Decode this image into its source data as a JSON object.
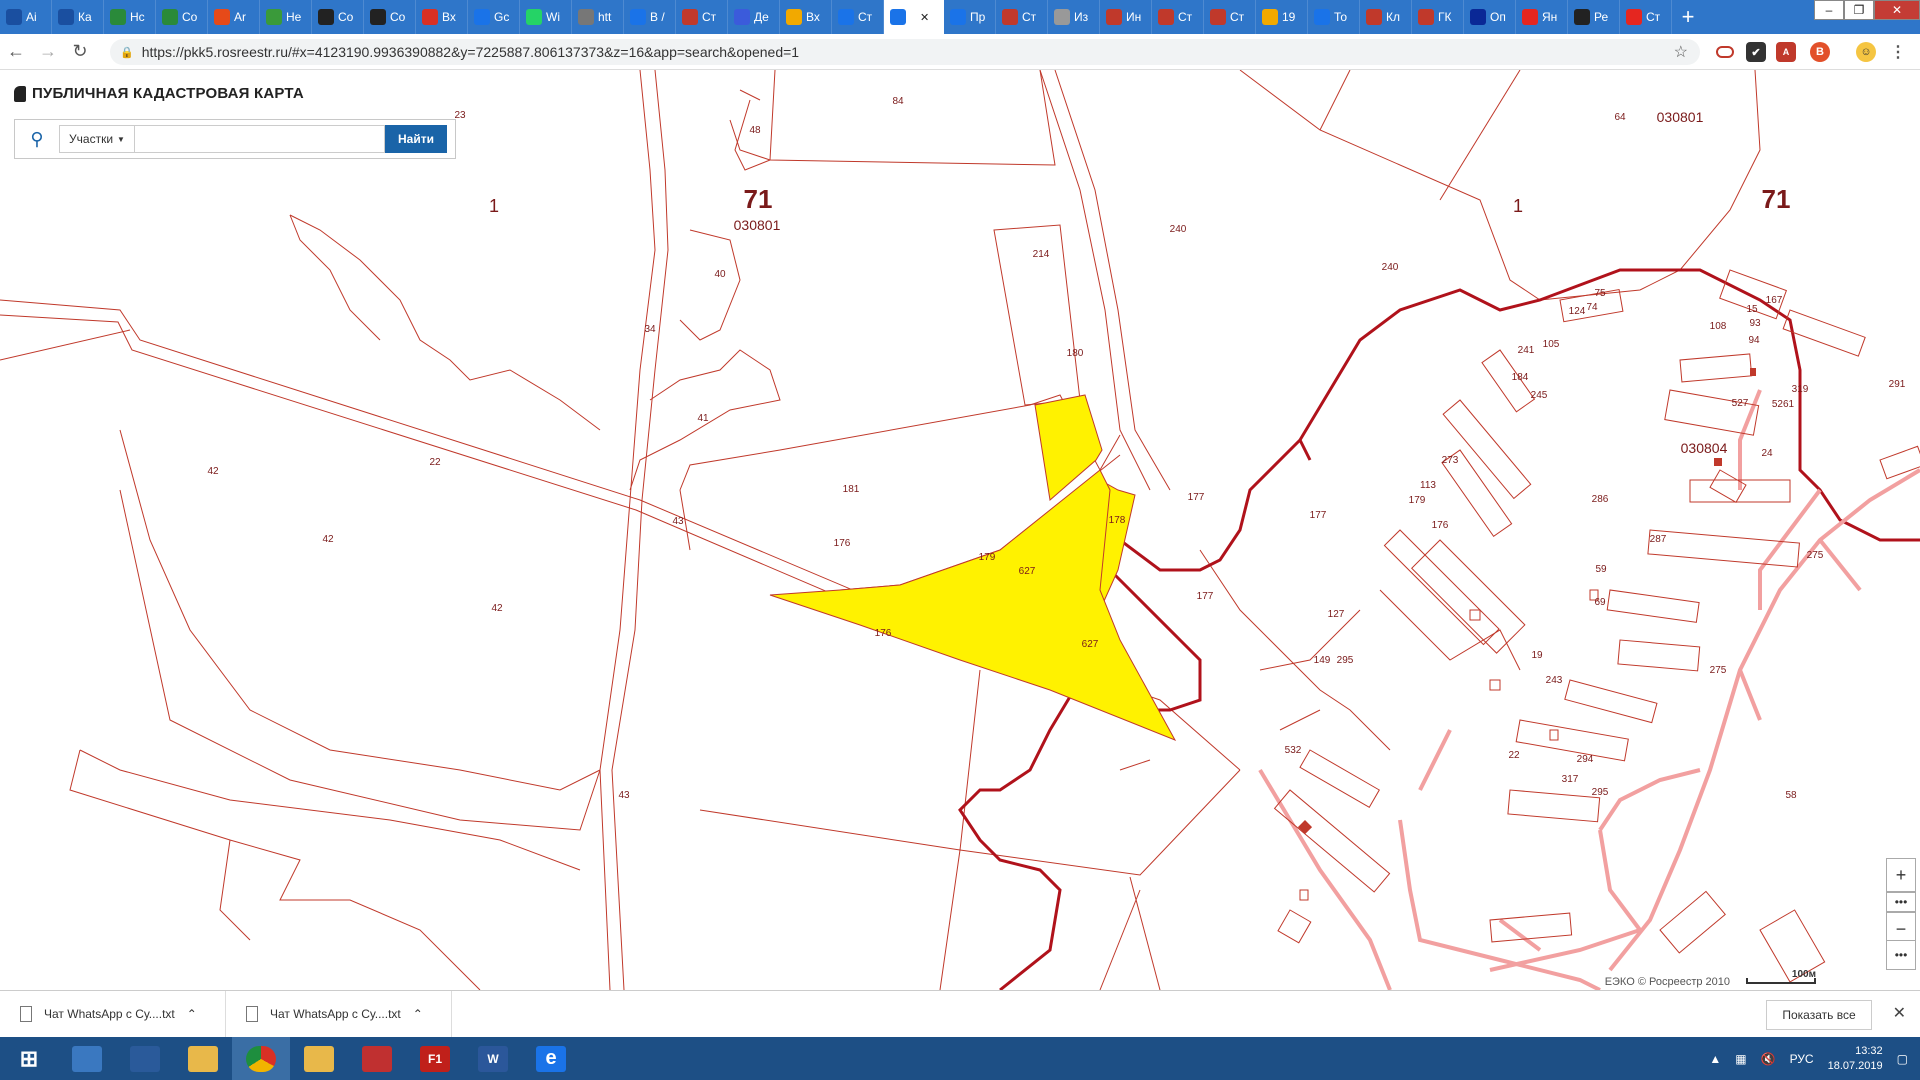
{
  "browser": {
    "tabs": [
      {
        "label": "Ai",
        "fav": "ru-flag-icon",
        "color": "#1a4fa0"
      },
      {
        "label": "Ка",
        "fav": "ru-flag-icon",
        "color": "#1a4fa0"
      },
      {
        "label": "Нс",
        "fav": "refresh-circle-icon",
        "color": "#2a8a3a"
      },
      {
        "label": "Co",
        "fav": "refresh-circle-icon",
        "color": "#2a8a3a"
      },
      {
        "label": "Ar",
        "fav": "windows-icon",
        "color": "#e64a19"
      },
      {
        "label": "Не",
        "fav": "leaf-icon",
        "color": "#3a9a3a"
      },
      {
        "label": "Co",
        "fav": "cb-icon",
        "color": "#222"
      },
      {
        "label": "Co",
        "fav": "cb-icon",
        "color": "#222"
      },
      {
        "label": "Вх",
        "fav": "gmail-icon",
        "color": "#d93025"
      },
      {
        "label": "Gc",
        "fav": "calendar-icon",
        "color": "#1a73e8"
      },
      {
        "label": "Wi",
        "fav": "whatsapp-icon",
        "color": "#25d366"
      },
      {
        "label": "htt",
        "fav": "globe-icon",
        "color": "#777"
      },
      {
        "label": "В /",
        "fav": "at-icon",
        "color": "#1a73e8"
      },
      {
        "label": "Ст",
        "fav": "person-icon",
        "color": "#c0392b"
      },
      {
        "label": "Де",
        "fav": "check-circle-icon",
        "color": "#3b5bdb"
      },
      {
        "label": "Вх",
        "fav": "mail-icon",
        "color": "#f2a900"
      },
      {
        "label": "Ст",
        "fav": "map-pin-icon",
        "color": "#1a73e8"
      },
      {
        "label": "",
        "fav": "map-pin-icon",
        "color": "#1a73e8",
        "active": true
      },
      {
        "label": "Пр",
        "fav": "circle-icon",
        "color": "#1a73e8"
      },
      {
        "label": "Ст",
        "fav": "person-icon",
        "color": "#c0392b"
      },
      {
        "label": "Из",
        "fav": "blank-icon",
        "color": "#999"
      },
      {
        "label": "Ин",
        "fav": "hammer-icon",
        "color": "#c0392b"
      },
      {
        "label": "Ст",
        "fav": "person-icon",
        "color": "#c0392b"
      },
      {
        "label": "Ст",
        "fav": "person-icon",
        "color": "#c0392b"
      },
      {
        "label": "19",
        "fav": "mail-icon",
        "color": "#f2a900"
      },
      {
        "label": "То",
        "fav": "bird-icon",
        "color": "#1a73e8"
      },
      {
        "label": "Кл",
        "fav": "person-icon",
        "color": "#c0392b"
      },
      {
        "label": "ГК",
        "fav": "person-icon",
        "color": "#c0392b"
      },
      {
        "label": "Оп",
        "fav": "vtb-icon",
        "color": "#0a2896"
      },
      {
        "label": "Ян",
        "fav": "yandex-icon",
        "color": "#e52620"
      },
      {
        "label": "Ре",
        "fav": "d-icon",
        "color": "#222"
      },
      {
        "label": "Ст",
        "fav": "pin-icon",
        "color": "#e52620"
      }
    ],
    "new_tab_label": "+",
    "url": "https://pkk5.rosreestr.ru/#x=4123190.9936390882&y=7225887.806137373&z=16&app=search&opened=1"
  },
  "app": {
    "title": "ПУБЛИЧНАЯ КАДАСТРОВАЯ КАРТА",
    "search_type": "Участки",
    "search_placeholder": "",
    "find_label": "Найти"
  },
  "map": {
    "parcel_labels": [
      {
        "t": "84"
      },
      {
        "t": "48"
      },
      {
        "t": "64"
      },
      {
        "t": "030801"
      },
      {
        "t": "1"
      },
      {
        "t": "71",
        "big": true
      },
      {
        "t": "71",
        "big": true
      },
      {
        "t": "030801"
      },
      {
        "t": "1"
      },
      {
        "t": "240"
      },
      {
        "t": "240"
      },
      {
        "t": "40"
      },
      {
        "t": "214"
      },
      {
        "t": "34"
      },
      {
        "t": "15"
      },
      {
        "t": "41"
      },
      {
        "t": "180"
      },
      {
        "t": "181"
      },
      {
        "t": "178"
      },
      {
        "t": "179"
      },
      {
        "t": "177"
      },
      {
        "t": "177"
      },
      {
        "t": "177"
      },
      {
        "t": "22"
      },
      {
        "t": "42"
      },
      {
        "t": "42"
      },
      {
        "t": "42"
      },
      {
        "t": "43"
      },
      {
        "t": "43"
      },
      {
        "t": "176"
      },
      {
        "t": "176"
      },
      {
        "t": "627"
      },
      {
        "t": "627"
      },
      {
        "t": "167"
      },
      {
        "t": "108"
      },
      {
        "t": "93"
      },
      {
        "t": "94"
      },
      {
        "t": "75"
      },
      {
        "t": "74"
      },
      {
        "t": "124"
      },
      {
        "t": "319"
      },
      {
        "t": "291"
      },
      {
        "t": "527"
      },
      {
        "t": "5261"
      },
      {
        "t": "030804"
      },
      {
        "t": "24"
      },
      {
        "t": "273"
      },
      {
        "t": "113"
      },
      {
        "t": "179"
      },
      {
        "t": "176"
      },
      {
        "t": "286"
      },
      {
        "t": "287"
      },
      {
        "t": "59"
      },
      {
        "t": "275"
      },
      {
        "t": "275"
      },
      {
        "t": "69"
      },
      {
        "t": "127"
      },
      {
        "t": "295"
      },
      {
        "t": "149"
      },
      {
        "t": "19"
      },
      {
        "t": "243"
      },
      {
        "t": "532"
      },
      {
        "t": "22"
      },
      {
        "t": "294"
      },
      {
        "t": "317"
      },
      {
        "t": "295"
      },
      {
        "t": "58"
      },
      {
        "t": "241"
      },
      {
        "t": "105"
      },
      {
        "t": "184"
      },
      {
        "t": "245"
      },
      {
        "t": "23"
      }
    ],
    "attribution": "ЕЭКО © Росреестр 2010",
    "scale": "100м",
    "highlight_color": "#fff200",
    "boundary_color": "#c0392b"
  },
  "downloads": {
    "items": [
      {
        "name": "Чат WhatsApp с Су....txt"
      },
      {
        "name": "Чат WhatsApp с Су....txt"
      }
    ],
    "show_all": "Показать все"
  },
  "taskbar": {
    "apps": [
      {
        "name": "start",
        "color": "#1d4f85"
      },
      {
        "name": "network",
        "color": "#3a78c0"
      },
      {
        "name": "powershell",
        "color": "#2a5a9a"
      },
      {
        "name": "explorer",
        "color": "#e8b84a"
      },
      {
        "name": "chrome",
        "color": "#d93025"
      },
      {
        "name": "certificate",
        "color": "#e8b84a"
      },
      {
        "name": "app-c",
        "color": "#c03030"
      },
      {
        "name": "f1",
        "color": "#c0201a"
      },
      {
        "name": "word",
        "color": "#2b579a"
      },
      {
        "name": "ie",
        "color": "#1a73e8"
      }
    ],
    "lang": "РУС",
    "time": "13:32",
    "date": "18.07.2019"
  }
}
